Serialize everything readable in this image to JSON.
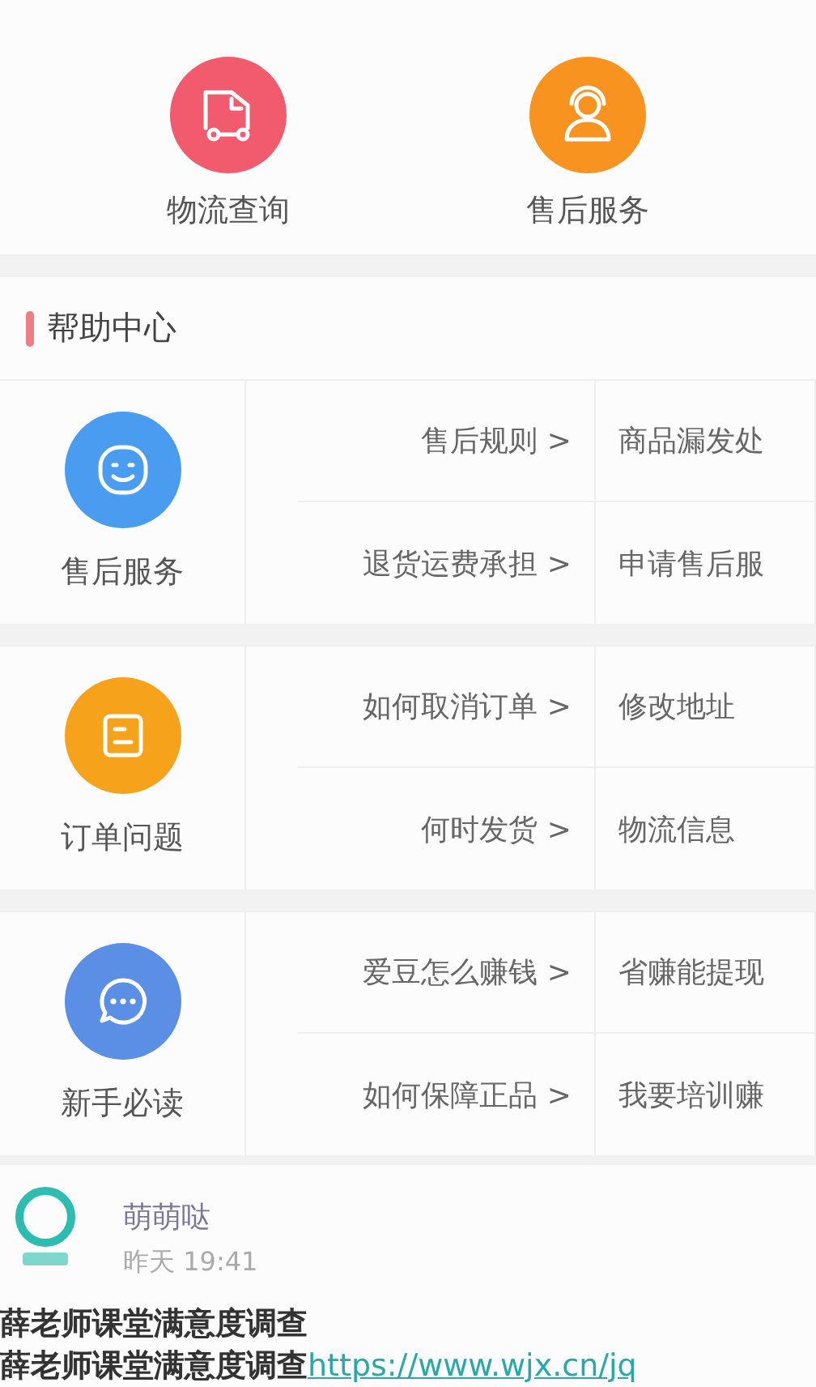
{
  "quick_actions": [
    {
      "label": "物流查询",
      "kind": "truck",
      "color": "#f25a6e"
    },
    {
      "label": "售后服务",
      "kind": "agent",
      "color": "#f7931e"
    }
  ],
  "help_center": {
    "title": "帮助中心"
  },
  "groups": [
    {
      "label": "售后服务",
      "kind": "smile",
      "color": "#4a9cf0",
      "links": [
        [
          {
            "text": "售后规则",
            "arrow": ">"
          },
          {
            "text": "商品漏发处"
          }
        ],
        [
          {
            "text": "退货运费承担",
            "arrow": ">"
          },
          {
            "text": "申请售后服"
          }
        ]
      ]
    },
    {
      "label": "订单问题",
      "kind": "note",
      "color": "#f7a21b",
      "links": [
        [
          {
            "text": "如何取消订单",
            "arrow": ">"
          },
          {
            "text": "修改地址"
          }
        ],
        [
          {
            "text": "何时发货",
            "arrow": ">"
          },
          {
            "text": "物流信息"
          }
        ]
      ]
    },
    {
      "label": "新手必读",
      "kind": "chat",
      "color": "#5b8fe6",
      "links": [
        [
          {
            "text": "爱豆怎么赚钱",
            "arrow": ">"
          },
          {
            "text": "省赚能提现"
          }
        ],
        [
          {
            "text": "如何保障正品",
            "arrow": ">"
          },
          {
            "text": "我要培训赚"
          }
        ]
      ]
    }
  ],
  "message": {
    "author": "萌萌哒",
    "time": "昨天 19:41",
    "title": "薛老师课堂满意度调查",
    "body": "薛老师课堂满意度调查",
    "link": "https://www.wjx.cn/jq"
  }
}
